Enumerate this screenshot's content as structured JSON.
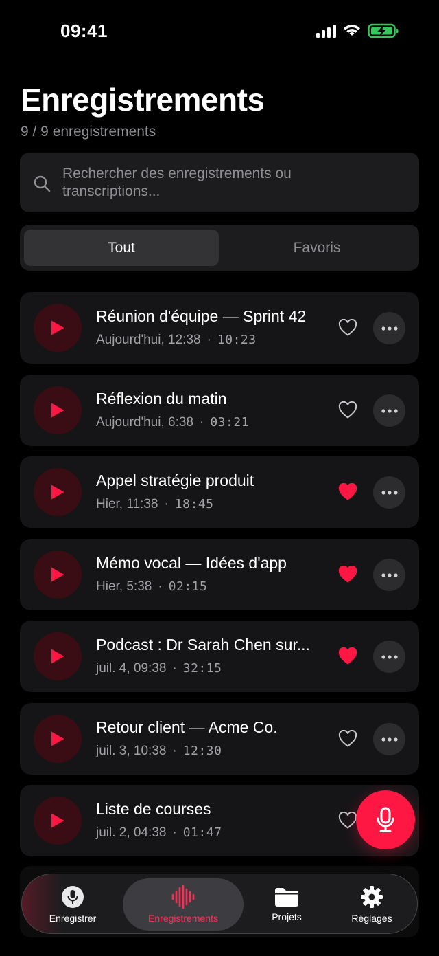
{
  "status_bar": {
    "time": "09:41"
  },
  "header": {
    "title": "Enregistrements",
    "count": "9 / 9 enregistrements"
  },
  "search": {
    "placeholder": "Rechercher des enregistrements ou transcriptions..."
  },
  "filter_tabs": [
    {
      "label": "Tout",
      "active": true
    },
    {
      "label": "Favoris",
      "active": false
    }
  ],
  "recordings": [
    {
      "title": "Réunion d'équipe — Sprint 42",
      "date": "Aujourd'hui, 12:38",
      "duration": "10:23",
      "favorite": false
    },
    {
      "title": "Réflexion du matin",
      "date": "Aujourd'hui, 6:38",
      "duration": "03:21",
      "favorite": false
    },
    {
      "title": "Appel stratégie produit",
      "date": "Hier, 11:38",
      "duration": "18:45",
      "favorite": true
    },
    {
      "title": "Mémo vocal — Idées d'app",
      "date": "Hier, 5:38",
      "duration": "02:15",
      "favorite": true
    },
    {
      "title": "Podcast : Dr Sarah Chen sur...",
      "date": "juil. 4, 09:38",
      "duration": "32:15",
      "favorite": true
    },
    {
      "title": "Retour client — Acme Co.",
      "date": "juil. 3, 10:38",
      "duration": "12:30",
      "favorite": false
    },
    {
      "title": "Liste de courses",
      "date": "juil. 2, 04:38",
      "duration": "01:47",
      "favorite": false
    }
  ],
  "tab_bar": [
    {
      "label": "Enregistrer",
      "icon": "microphone-icon"
    },
    {
      "label": "Enregistrements",
      "icon": "waveform-icon",
      "active": true
    },
    {
      "label": "Projets",
      "icon": "folder-icon"
    },
    {
      "label": "Réglages",
      "icon": "gear-icon"
    }
  ],
  "colors": {
    "accent": "#ff1744",
    "background": "#000000",
    "card": "#151517",
    "secondary_text": "#8e8e93"
  }
}
